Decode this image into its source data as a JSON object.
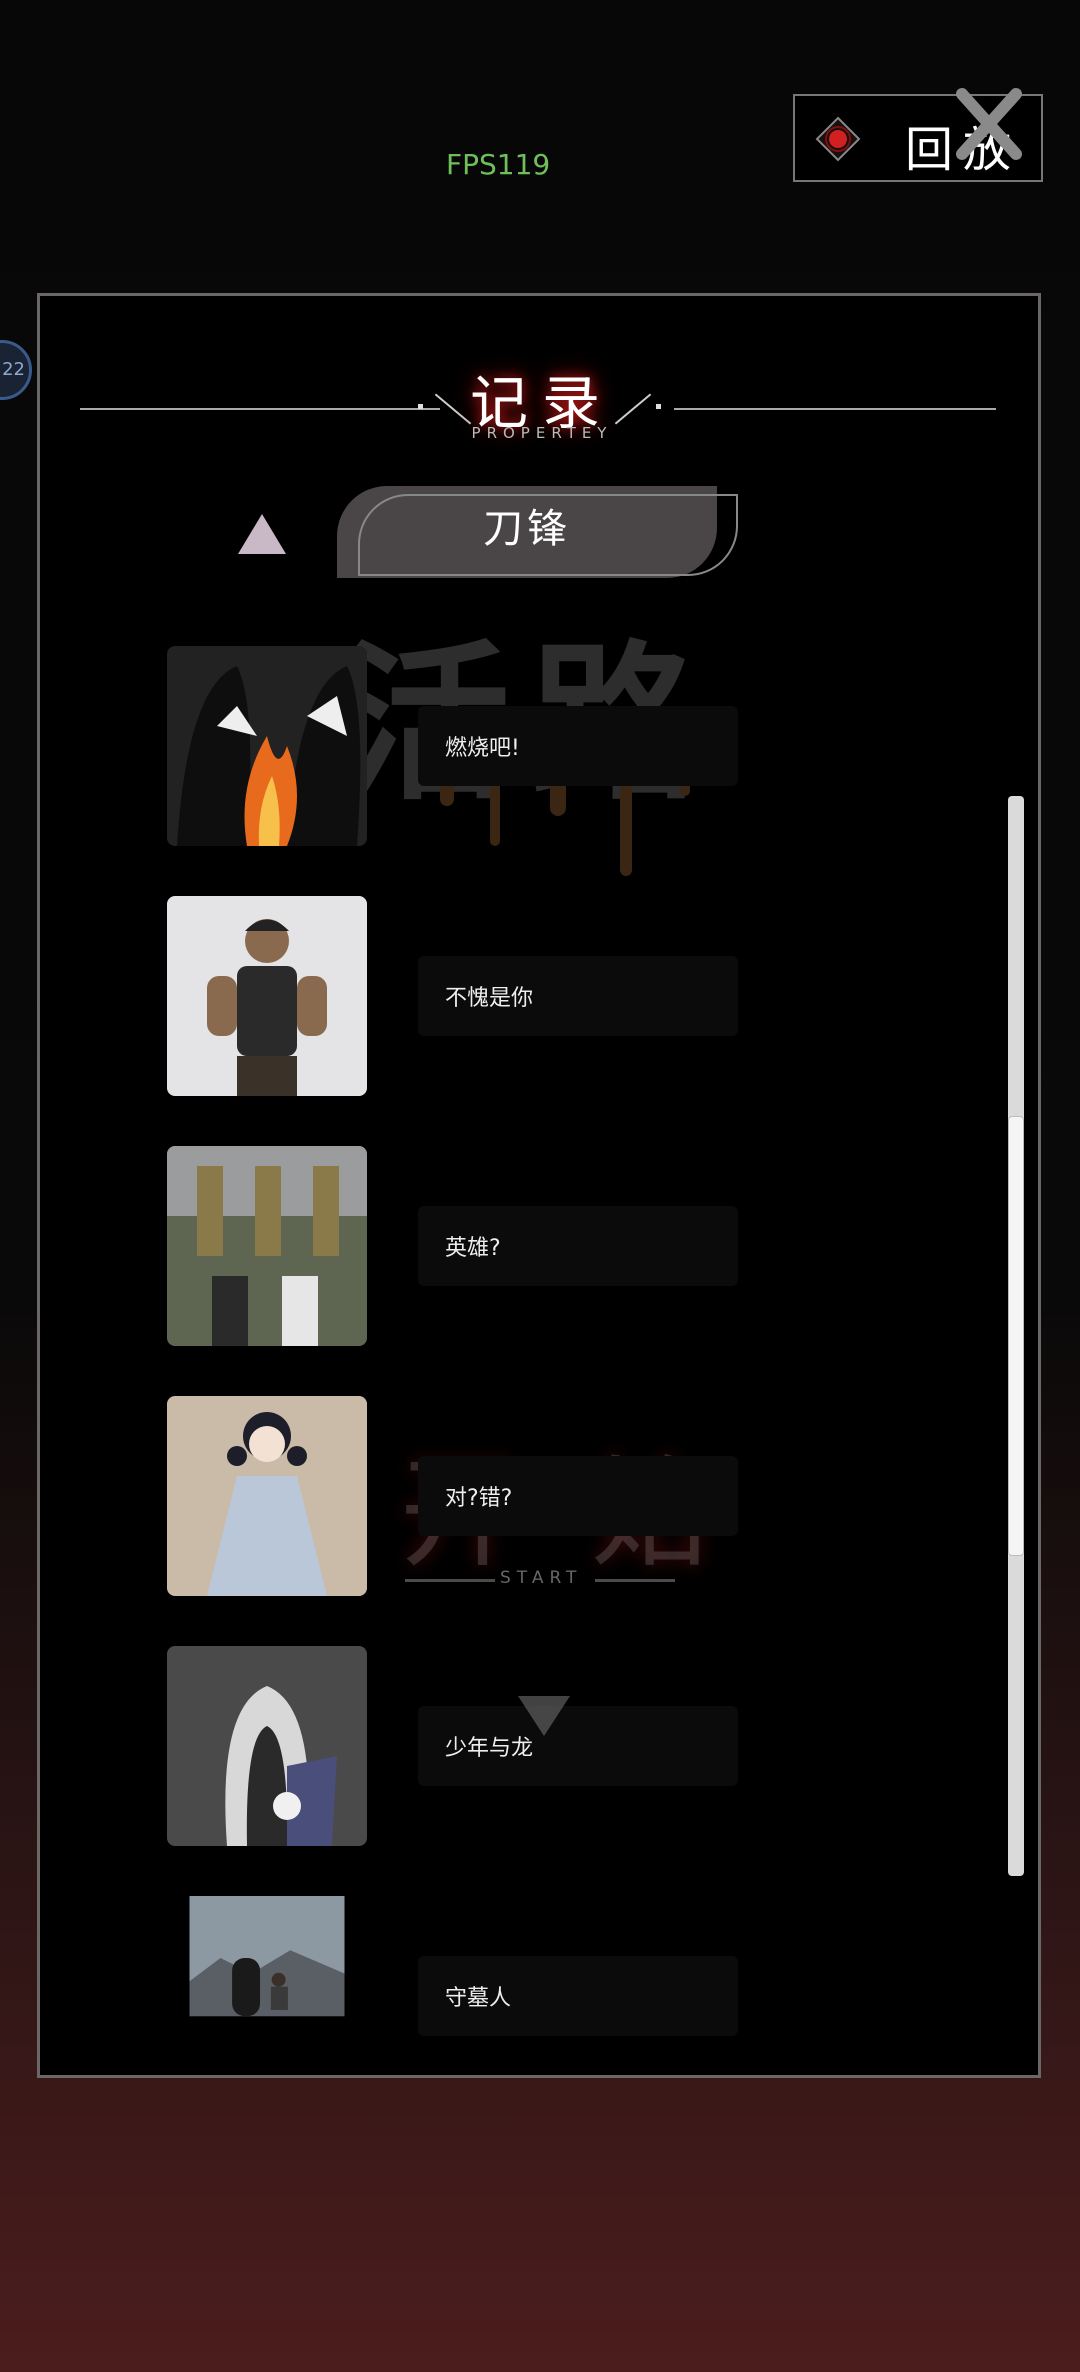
{
  "hud": {
    "fps": "FPS119",
    "side_badge": "22"
  },
  "replay": {
    "label": "回放"
  },
  "panel": {
    "title": "记录",
    "subtitle": "PROPERTEY"
  },
  "tab": {
    "label": "刀锋"
  },
  "background": {
    "ghost_title": "活路",
    "start_label": "开始",
    "start_sub": "START"
  },
  "entries": [
    {
      "label": "燃烧吧!"
    },
    {
      "label": "不愧是你"
    },
    {
      "label": "英雄?"
    },
    {
      "label": "对?错?"
    },
    {
      "label": "少年与龙"
    },
    {
      "label": "守墓人"
    }
  ],
  "colors": {
    "accent_red": "#c01a1a",
    "fps_green": "#6fbf5a"
  }
}
